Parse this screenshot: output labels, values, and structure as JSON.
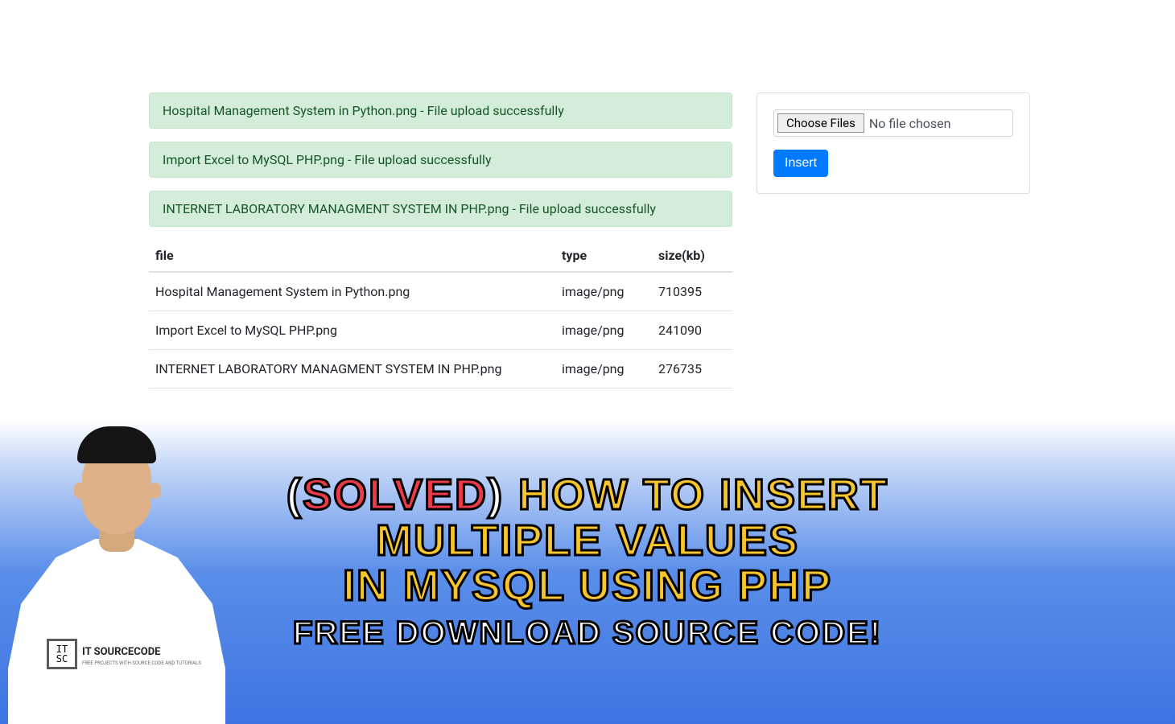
{
  "alerts": {
    "a0": "Hospital Management System in Python.png - File upload successfully",
    "a1": "Import Excel to MySQL PHP.png - File upload successfully",
    "a2": "INTERNET LABORATORY MANAGMENT SYSTEM IN PHP.png - File upload successfully"
  },
  "table": {
    "headers": {
      "file": "file",
      "type": "type",
      "size": "size(kb)"
    },
    "rows": {
      "r0": {
        "file": "Hospital Management System in Python.png",
        "type": "image/png",
        "size": "710395"
      },
      "r1": {
        "file": "Import Excel to MySQL PHP.png",
        "type": "image/png",
        "size": "241090"
      },
      "r2": {
        "file": "INTERNET LABORATORY MANAGMENT SYSTEM IN PHP.png",
        "type": "image/png",
        "size": "276735"
      }
    }
  },
  "form": {
    "choose_label": "Choose Files",
    "no_file_text": "No file chosen",
    "insert_label": "Insert"
  },
  "hero": {
    "bracket_open": "(",
    "solved": "SOLVED",
    "bracket_close": ")",
    "line1_right": "HOW TO INSERT",
    "line2": "MULTIPLE VALUES",
    "line3": "IN MYSQL USING PHP",
    "sub": "FREE DOWNLOAD SOURCE CODE!"
  },
  "brand": {
    "logo_text": "IT\nSC",
    "brand_name": "IT SOURCECODE",
    "brand_tag": "FREE PROJECTS WITH SOURCE CODE AND TUTORIALS"
  }
}
